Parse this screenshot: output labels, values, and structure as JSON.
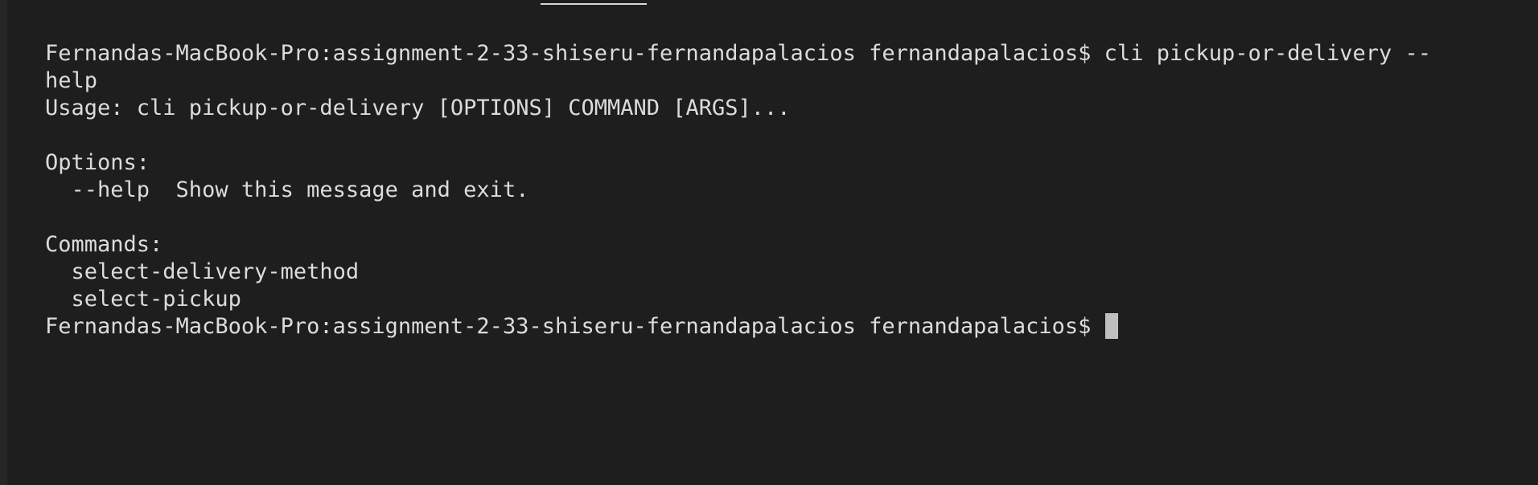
{
  "terminal": {
    "lines": [
      "Fernandas-MacBook-Pro:assignment-2-33-shiseru-fernandapalacios fernandapalacios$ cli pickup-or-delivery --",
      "help",
      "Usage: cli pickup-or-delivery [OPTIONS] COMMAND [ARGS]...",
      "",
      "Options:",
      "  --help  Show this message and exit.",
      "",
      "Commands:",
      "  select-delivery-method",
      "  select-pickup"
    ],
    "prompt": "Fernandas-MacBook-Pro:assignment-2-33-shiseru-fernandapalacios fernandapalacios$ "
  },
  "colors": {
    "background": "#1e1e1e",
    "text": "#dcdcdc",
    "cursor": "#bfbfbf"
  }
}
